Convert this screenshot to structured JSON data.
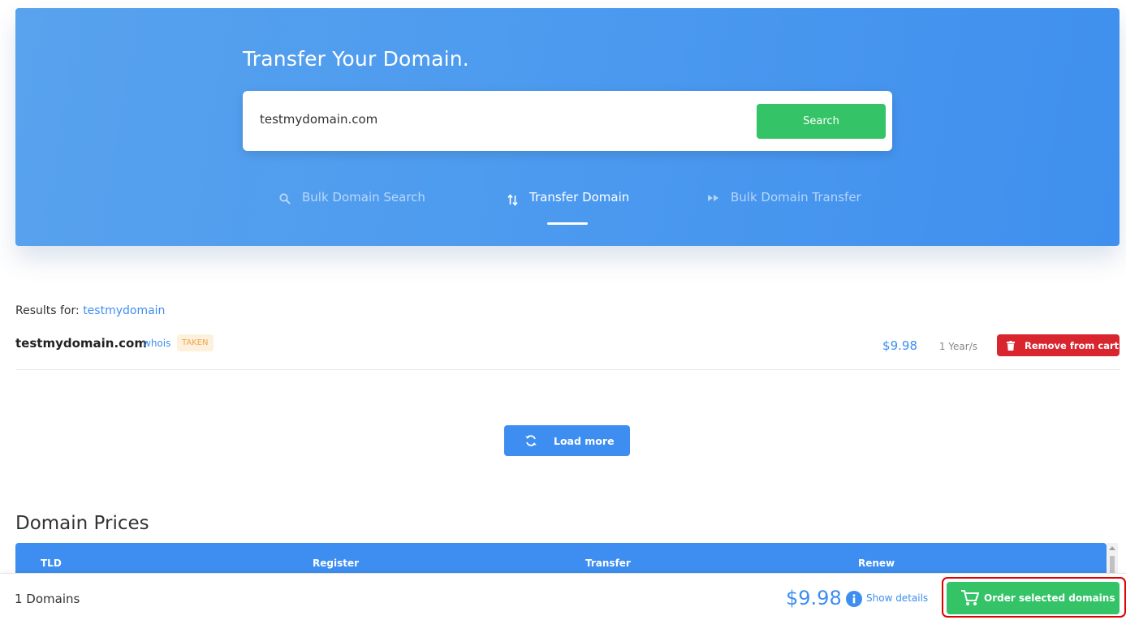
{
  "hero": {
    "title": "Transfer Your Domain.",
    "search_value": "testmydomain.com",
    "search_button": "Search",
    "tabs": [
      {
        "label": "Bulk Domain Search",
        "icon": "search-icon",
        "active": false
      },
      {
        "label": "Transfer Domain",
        "icon": "transfer-icon",
        "active": true
      },
      {
        "label": "Bulk Domain Transfer",
        "icon": "fast-forward-icon",
        "active": false
      }
    ]
  },
  "results": {
    "label": "Results for:",
    "query": "testmydomain",
    "items": [
      {
        "domain": "testmydomain.com",
        "whois": "whois",
        "status": "TAKEN",
        "price": "$9.98",
        "period": "1 Year/s",
        "action": "Remove from cart"
      }
    ],
    "load_more": "Load more"
  },
  "domain_prices": {
    "title": "Domain Prices",
    "columns": [
      "TLD",
      "Register",
      "Transfer",
      "Renew"
    ]
  },
  "footer": {
    "count": "1 Domains",
    "total": "$9.98",
    "show_details": "Show details",
    "order_button": "Order selected domains"
  },
  "colors": {
    "primary": "#3d8ef0",
    "success": "#34c467",
    "danger": "#d9262e",
    "taken_bg": "#fdf0dc",
    "taken_text": "#f0a64a",
    "highlight": "#e00000"
  }
}
